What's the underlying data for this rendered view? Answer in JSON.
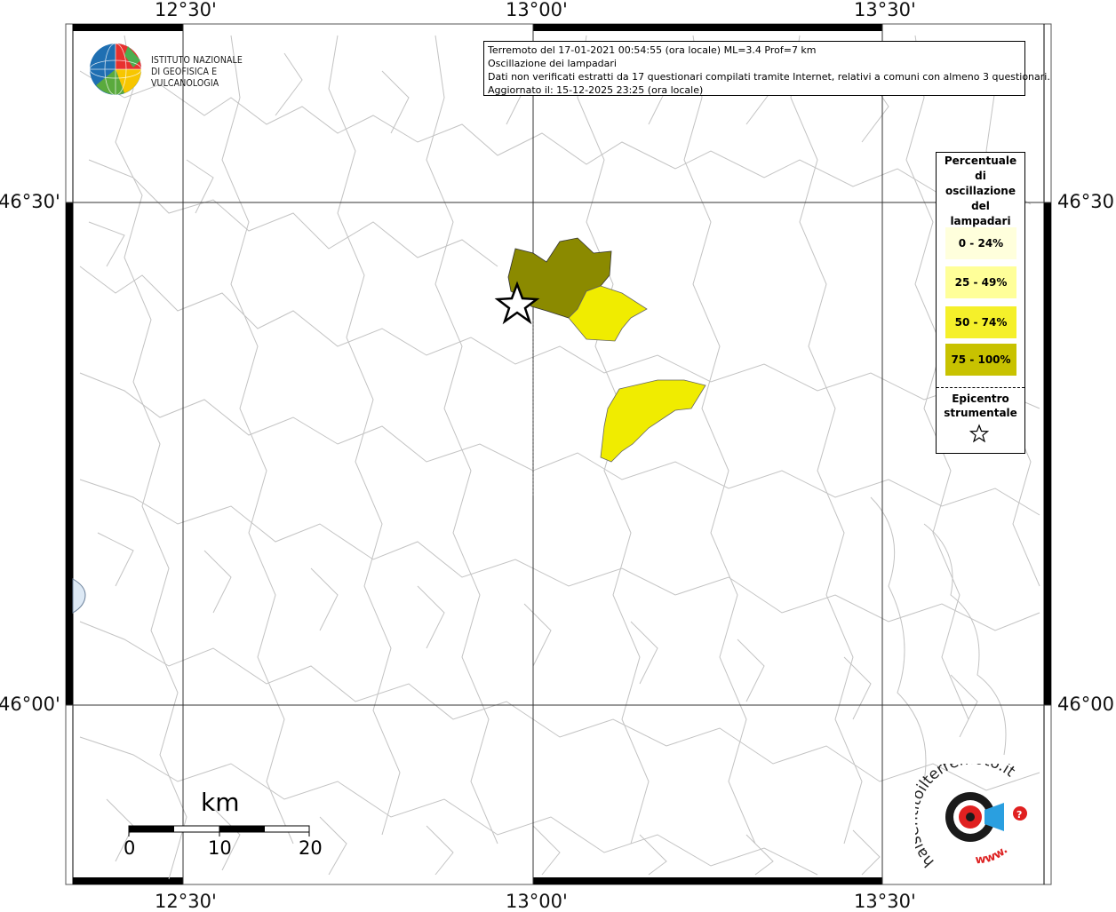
{
  "map": {
    "lon_labels": [
      "12°30'",
      "13°00'",
      "13°30'"
    ],
    "lat_labels": [
      "46°30'",
      "46°00'"
    ]
  },
  "logo": {
    "line1": "ISTITUTO NAZIONALE",
    "line2": "DI GEOFISICA E VULCANOLOGIA"
  },
  "info": {
    "line1": "Terremoto del 17-01-2021 00:54:55 (ora locale) ML=3.4 Prof=7 km",
    "line2": "Oscillazione dei lampadari",
    "line3": "Dati non verificati estratti da 17 questionari compilati tramite Internet, relativi a comuni con almeno 3 questionari.",
    "line4": "Aggiornato il: 15-12-2025 23:25 (ora locale)"
  },
  "legend": {
    "title_lines": [
      "Percentuale",
      "di",
      "oscillazione",
      "del",
      "lampadari"
    ],
    "items": [
      {
        "label": "0 - 24%",
        "color": "#ffffdc"
      },
      {
        "label": "25 - 49%",
        "color": "#ffff99"
      },
      {
        "label": "50 - 74%",
        "color": "#f5f02a"
      },
      {
        "label": "75 - 100%",
        "color": "#c8c200"
      }
    ],
    "epicenter_lines": [
      "Epicentro",
      "strumentale"
    ]
  },
  "scale": {
    "unit": "km",
    "ticks": [
      "0",
      "10",
      "20"
    ]
  },
  "regions": {
    "colors": {
      "dark": "#8b8a00",
      "yellow": "#f0ec00"
    }
  },
  "branding": {
    "site_text": "haisentitoilterremoto.it",
    "www_text": "www."
  }
}
